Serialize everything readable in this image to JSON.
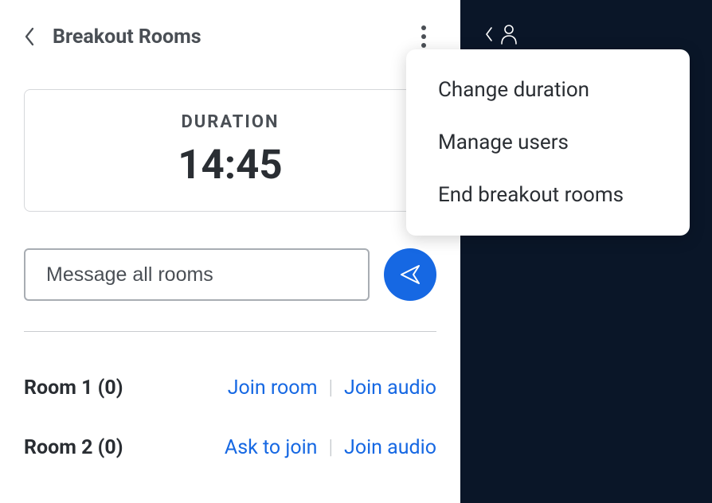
{
  "header": {
    "title": "Breakout Rooms"
  },
  "duration": {
    "label": "DURATION",
    "time": "14:45"
  },
  "message": {
    "placeholder": "Message all rooms"
  },
  "rooms": [
    {
      "name": "Room 1  (0)",
      "primary_action": "Join room",
      "secondary_action": "Join audio"
    },
    {
      "name": "Room 2  (0)",
      "primary_action": "Ask to join",
      "secondary_action": "Join audio"
    }
  ],
  "menu": {
    "items": [
      "Change duration",
      "Manage users",
      "End breakout rooms"
    ]
  }
}
